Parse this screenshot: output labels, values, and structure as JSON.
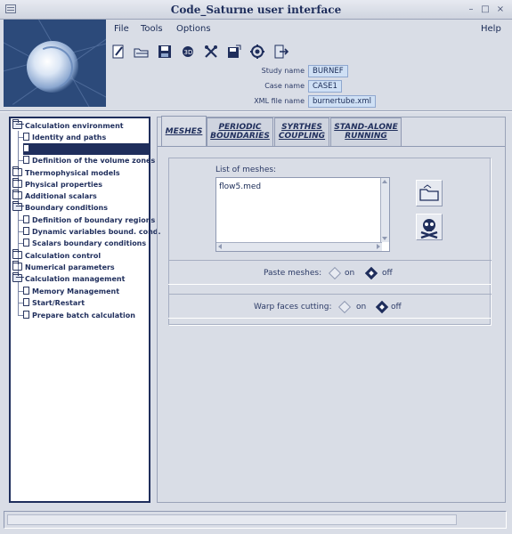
{
  "window": {
    "title": "Code_Saturne user interface"
  },
  "menu": {
    "file": {
      "label": "File"
    },
    "tools": {
      "label": "Tools"
    },
    "options": {
      "label": "Options"
    },
    "help": {
      "label": "Help"
    }
  },
  "toolbar": {
    "icons": [
      "new-case-icon",
      "open-folder-icon",
      "save-icon",
      "3d-view-icon",
      "tools-icon",
      "save-as-icon",
      "preferences-icon",
      "quit-icon"
    ]
  },
  "study_info": {
    "study_label": "Study name",
    "study_value": "BURNEF",
    "case_label": "Case name",
    "case_value": "CASE1",
    "xml_label": "XML file name",
    "xml_value": "burnertube.xml"
  },
  "tree": [
    {
      "label": "Calculation environment",
      "type": "folder-open"
    },
    {
      "label": "Identity and paths",
      "type": "doc"
    },
    {
      "label": "",
      "type": "doc",
      "selected": true
    },
    {
      "label": "Definition of the volume zones",
      "type": "doc"
    },
    {
      "label": "Thermophysical models",
      "type": "folder"
    },
    {
      "label": "Physical properties",
      "type": "folder"
    },
    {
      "label": "Additional scalars",
      "type": "folder"
    },
    {
      "label": "Boundary conditions",
      "type": "folder-open"
    },
    {
      "label": "Definition of boundary regions",
      "type": "doc"
    },
    {
      "label": "Dynamic variables bound. cond.",
      "type": "doc"
    },
    {
      "label": "Scalars boundary conditions",
      "type": "doc"
    },
    {
      "label": "Calculation control",
      "type": "folder"
    },
    {
      "label": "Numerical parameters",
      "type": "folder"
    },
    {
      "label": "Calculation management",
      "type": "folder-open"
    },
    {
      "label": "Memory Management",
      "type": "doc"
    },
    {
      "label": "Start/Restart",
      "type": "doc"
    },
    {
      "label": "Prepare batch calculation",
      "type": "doc"
    }
  ],
  "tabs": [
    {
      "label": "MESHES",
      "active": true
    },
    {
      "label": "PERIODIC BOUNDARIES",
      "active": false
    },
    {
      "label": "SYRTHES COUPLING",
      "active": false
    },
    {
      "label": "STAND-ALONE RUNNING",
      "active": false
    }
  ],
  "meshes": {
    "list_label": "List of meshes:",
    "items": [
      "flow5.med"
    ],
    "add_button_icon": "folder-icon",
    "delete_button_icon": "skull-crossbones-icon"
  },
  "paste_meshes": {
    "label": "Paste meshes:",
    "on_label": "on",
    "off_label": "off",
    "selected": "off"
  },
  "warp_faces": {
    "label": "Warp faces cutting:",
    "on_label": "on",
    "off_label": "off",
    "selected": "off"
  }
}
